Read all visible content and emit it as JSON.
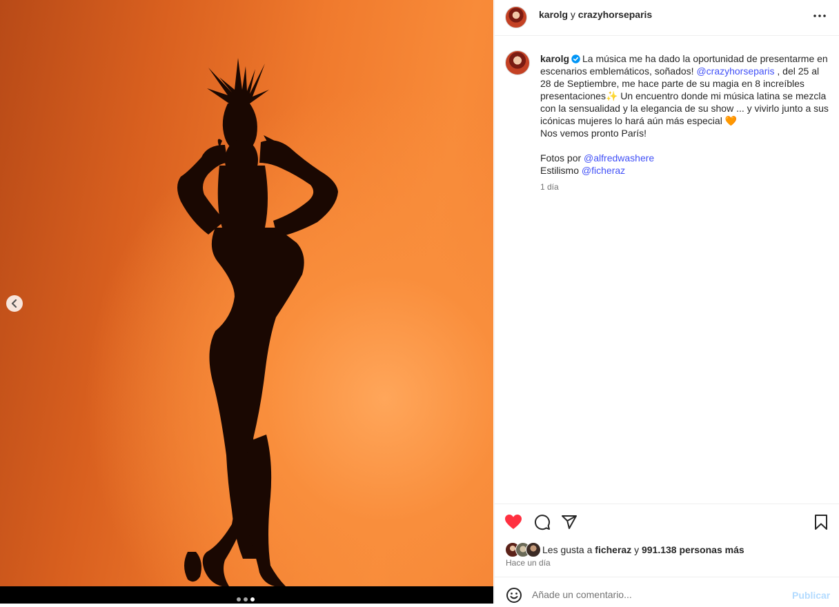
{
  "post": {
    "header_user": "karolg",
    "header_connector": "y",
    "header_collab": "crazyhorseparis",
    "caption_user": "karolg",
    "caption_lines": [
      "La música me ha dado la oportunidad de presentarme en",
      "escenarios emblemáticos, soñados!",
      "@crazyhorseparis",
      ", del 25 al 28",
      "de Septiembre, me hace parte de su magia en 8 increíbles",
      "presentaciones✨ Un encuentro donde mi música latina se mezcla",
      "con la sensualidad y la elegancia de su show ... y vivirlo junto a sus",
      "icónicas mujeres lo hará aún más especial 🧡",
      "Nos vemos pronto París!"
    ],
    "photos_label": "Fotos por",
    "photos_mention": "@alfredwashere",
    "styling_label": "Estilismo",
    "styling_mention": "@ficheraz",
    "caption_time": "1 día"
  },
  "engagement": {
    "likes_prefix": "Les gusta a",
    "likes_user": "ficheraz",
    "likes_connector": "y",
    "likes_count": "991.138 personas más",
    "time_ago": "Hace un día"
  },
  "comment": {
    "placeholder": "Añade un comentario...",
    "publish_label": "Publicar"
  },
  "carousel": {
    "total_slides": 3,
    "active_slide": 3
  },
  "icons": {
    "like": "heart-icon",
    "comment": "comment-icon",
    "share": "share-icon",
    "save": "bookmark-icon",
    "more": "more-icon",
    "emoji": "emoji-icon",
    "prev": "chevron-left-icon",
    "verified": "verified-badge-icon"
  },
  "colors": {
    "like_active": "#ff3040",
    "mention": "#4150f7",
    "verified": "#0095f6",
    "publish_disabled": "#b3dbff"
  }
}
